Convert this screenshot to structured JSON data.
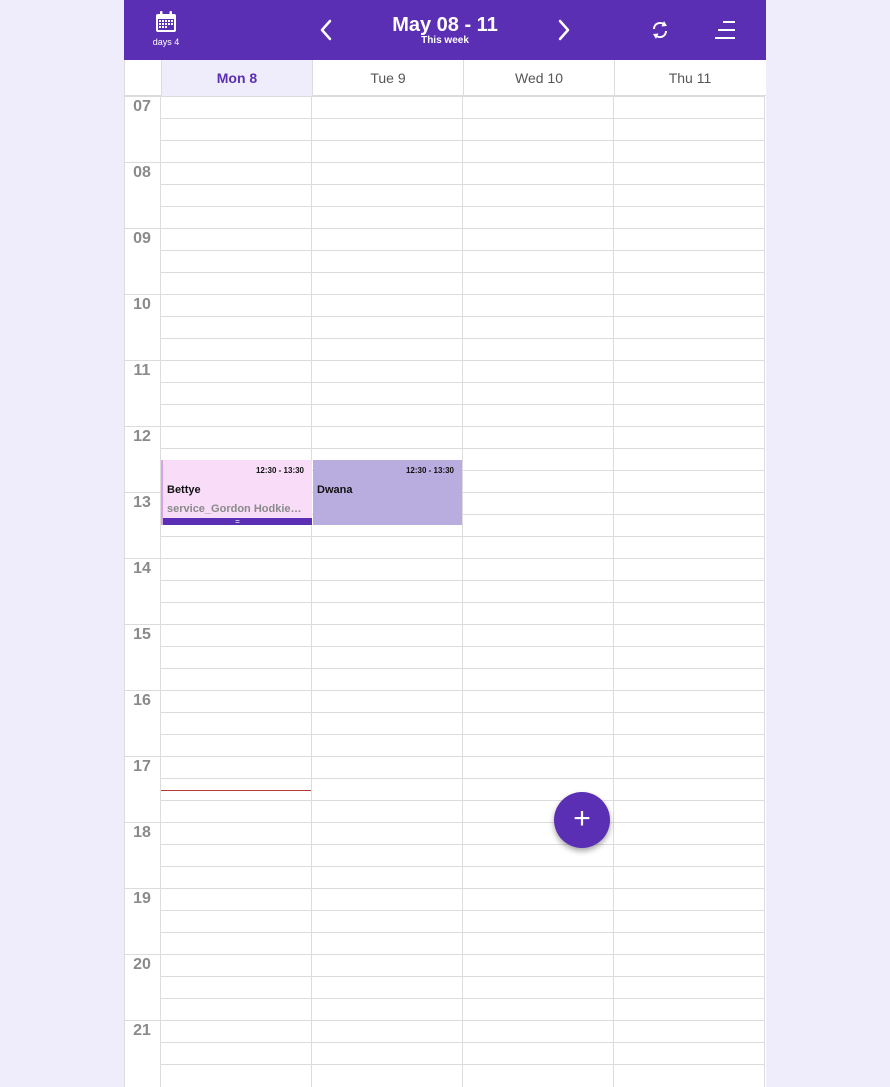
{
  "header": {
    "view_label": "days 4",
    "title": "May 08 - 11",
    "subtitle": "This week",
    "icons": {
      "view": "calendar-icon",
      "prev": "chevron-left-icon",
      "next": "chevron-right-icon",
      "refresh": "refresh-icon",
      "menu": "menu-icon"
    }
  },
  "days": [
    {
      "label": "Mon 8",
      "active": true
    },
    {
      "label": "Tue 9",
      "active": false
    },
    {
      "label": "Wed 10",
      "active": false
    },
    {
      "label": "Thu 11",
      "active": false
    }
  ],
  "hours": [
    "07",
    "08",
    "09",
    "10",
    "11",
    "12",
    "13",
    "14",
    "15",
    "16",
    "17",
    "18",
    "19",
    "20",
    "21"
  ],
  "events": {
    "bettye": {
      "day": "Mon 8",
      "time": "12:30 - 13:30",
      "name": "Bettye",
      "service": "service_Gordon Hodkiewicz",
      "handle": "="
    },
    "dwana": {
      "day": "Tue 9",
      "time": "12:30 - 13:30",
      "name": "Dwana"
    }
  },
  "fab": {
    "label": "+",
    "icon": "plus-icon"
  },
  "colors": {
    "primary": "#5b2fb3",
    "event_bettye": "#f8dcf8",
    "event_dwana": "#b9addf",
    "now_line": "#b53b3b"
  }
}
